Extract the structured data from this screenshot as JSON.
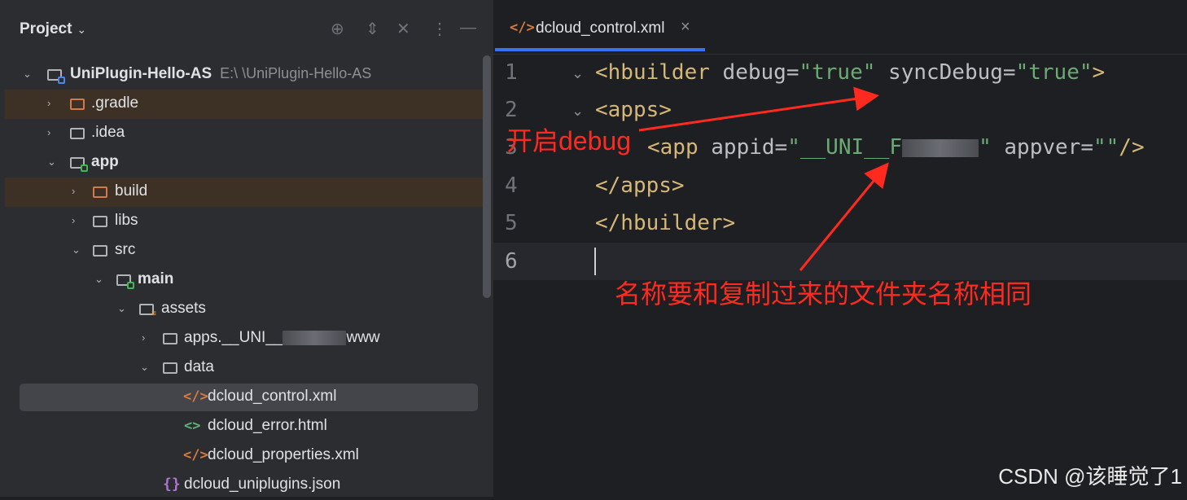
{
  "project_header": {
    "title": "Project",
    "chevron": "⌄"
  },
  "header_icons": [
    "locate-icon",
    "expand-icon",
    "collapse-icon",
    "more-icon",
    "minimize-icon"
  ],
  "tree": [
    {
      "label": "UniPlugin-Hello-AS",
      "path": "E:\\    \\UniPlugin-Hello-AS",
      "bold": true,
      "icon": "module-folder-icon"
    },
    {
      "label": ".gradle",
      "icon": "folder-icon"
    },
    {
      "label": ".idea",
      "icon": "folder-icon"
    },
    {
      "label": "app",
      "bold": true,
      "icon": "module-folder-icon"
    },
    {
      "label": "build",
      "icon": "folder-icon"
    },
    {
      "label": "libs",
      "icon": "folder-icon"
    },
    {
      "label": "src",
      "icon": "folder-icon"
    },
    {
      "label": "main",
      "bold": true,
      "icon": "source-folder-icon"
    },
    {
      "label": "assets",
      "icon": "resources-folder-icon"
    },
    {
      "label_prefix": "apps.__UNI__",
      "label_suffix": "www",
      "icon": "folder-icon"
    },
    {
      "label": "data",
      "icon": "folder-icon"
    },
    {
      "label": "dcloud_control.xml",
      "icon": "xml-file-icon"
    },
    {
      "label": "dcloud_error.html",
      "icon": "html-file-icon"
    },
    {
      "label": "dcloud_properties.xml",
      "icon": "xml-file-icon"
    },
    {
      "label": "dcloud_uniplugins.json",
      "icon": "json-file-icon"
    }
  ],
  "editor": {
    "tab": {
      "label": "dcloud_control.xml",
      "close": "×"
    },
    "line_numbers": [
      "1",
      "2",
      "3",
      "4",
      "5",
      "6"
    ],
    "current_line": "6",
    "code": {
      "l1_open": "<hbuilder ",
      "l1_attr1": "debug=",
      "l1_val1": "\"true\"",
      "l1_attr2": " syncDebug=",
      "l1_val2": "\"true\"",
      "l1_close": ">",
      "l2": "<apps>",
      "l3_open": "<app ",
      "l3_attr1": "appid=",
      "l3_val1_prefix": "\"__UNI__F",
      "l3_val1_suffix": "\"",
      "l3_attr2": " appver=",
      "l3_val2": "\"\"",
      "l3_close": "/>",
      "l4": "</apps>",
      "l5": "</hbuilder>"
    }
  },
  "annotations": {
    "debug": "开启debug",
    "name": "名称要和复制过来的文件夹名称相同"
  },
  "watermark": "CSDN @该睡觉了1",
  "colors": {
    "annotation": "#ff2a1f",
    "tag": "#d5b778",
    "string": "#6aab73",
    "accent": "#3574f0"
  }
}
